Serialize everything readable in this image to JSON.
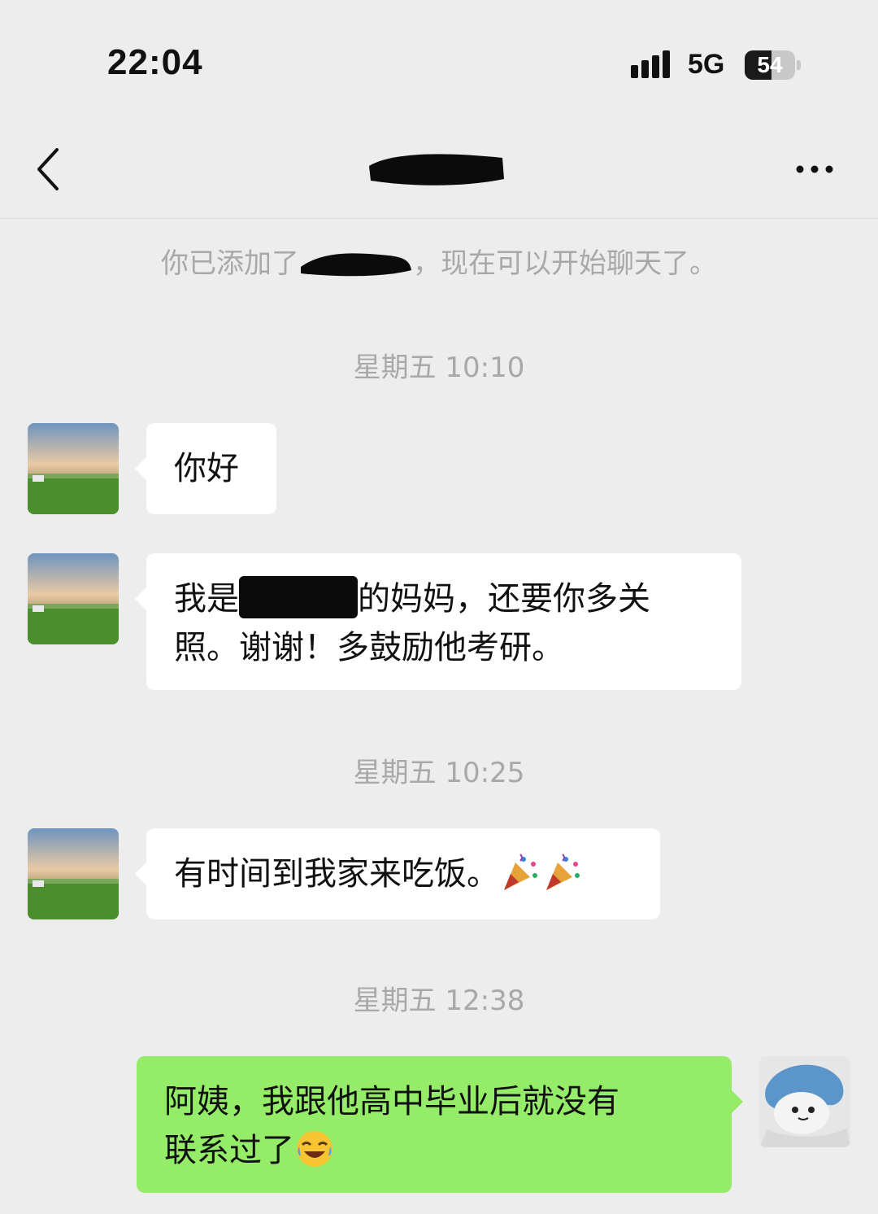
{
  "status_bar": {
    "time": "22:04",
    "network": "5G",
    "battery_level": "54",
    "battery_fraction": 0.54,
    "signal_icon": "signal-bars-icon",
    "battery_icon": "battery-icon"
  },
  "nav": {
    "back_icon": "chevron-left-icon",
    "more_icon": "more-dots-icon",
    "title_redacted": true
  },
  "system_notice": {
    "before": "你已添加了",
    "after": "，现在可以开始聊天了。"
  },
  "timestamps": [
    "星期五 10:10",
    "星期五 10:25",
    "星期五 12:38"
  ],
  "messages": [
    {
      "sender": "other",
      "text": "你好"
    },
    {
      "sender": "other",
      "before": "我是",
      "after_line1": "的妈妈，还要你多关",
      "line2": "照。谢谢！多鼓励他考研。"
    },
    {
      "sender": "other",
      "text": "有时间到我家来吃饭。",
      "emoji": [
        "party-popper-emoji",
        "party-popper-emoji"
      ]
    },
    {
      "sender": "self",
      "line1": "阿姨，我跟他高中毕业后就没有",
      "line2": "联系过了",
      "emoji": "laughing-crying-emoji"
    }
  ],
  "colors": {
    "background": "#ededed",
    "self_bubble": "#95ec69",
    "other_bubble": "#ffffff",
    "meta_text": "#a8a8a8"
  }
}
